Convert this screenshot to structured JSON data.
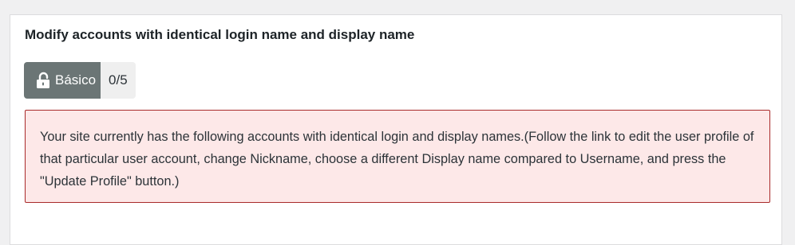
{
  "panel": {
    "title": "Modify accounts with identical login name and display name"
  },
  "level": {
    "icon": "unlocked-padlock-icon",
    "label": "Básico",
    "count": "0/5"
  },
  "notice": {
    "text": "Your site currently has the following accounts with identical login and display names.(Follow the link to edit the user profile of that particular user account, change Nickname, choose a different Display name compared to Username, and press the \"Update Profile\" button.)"
  },
  "colors": {
    "badge_bg": "#6b7575",
    "notice_bg": "#fde8e8",
    "notice_border": "#a92a2a"
  }
}
